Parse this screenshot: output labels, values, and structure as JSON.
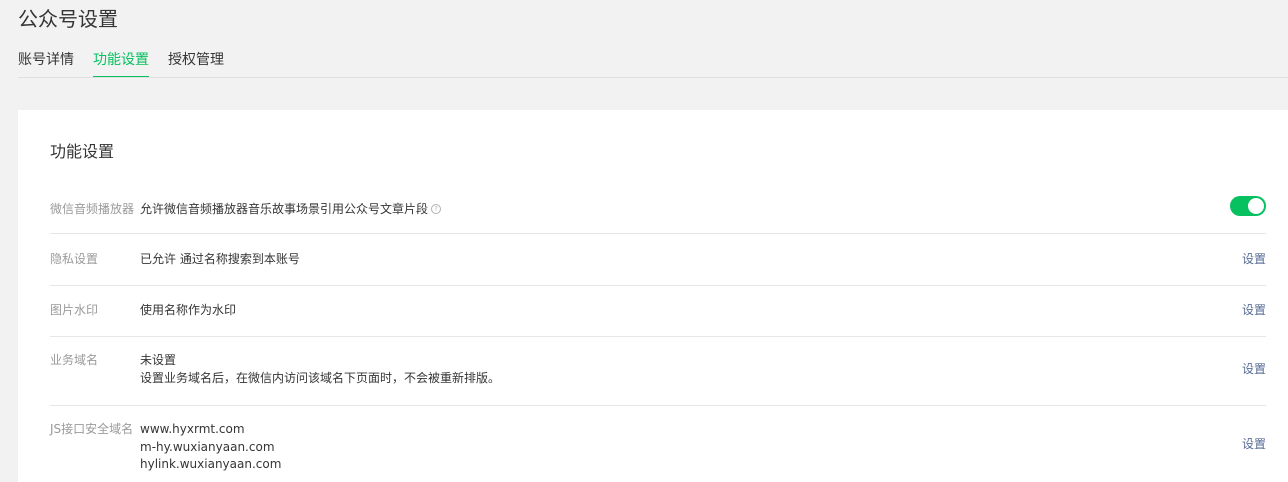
{
  "page": {
    "title": "公众号设置"
  },
  "tabs": [
    {
      "label": "账号详情",
      "active": false
    },
    {
      "label": "功能设置",
      "active": true
    },
    {
      "label": "授权管理",
      "active": false
    }
  ],
  "section": {
    "title": "功能设置"
  },
  "rows": {
    "player": {
      "label": "微信音频播放器",
      "content": "允许微信音频播放器音乐故事场景引用公众号文章片段",
      "help_icon": "?",
      "toggle_on": true
    },
    "privacy": {
      "label": "隐私设置",
      "content": "已允许 通过名称搜索到本账号",
      "action": "设置"
    },
    "watermark": {
      "label": "图片水印",
      "content": "使用名称作为水印",
      "action": "设置"
    },
    "business_domain": {
      "label": "业务域名",
      "line1": "未设置",
      "line2": "设置业务域名后，在微信内访问该域名下页面时，不会被重新排版。",
      "action": "设置"
    },
    "js_domain": {
      "label": "JS接口安全域名",
      "domains": [
        "www.hyxrmt.com",
        "m-hy.wuxianyaan.com",
        "hylink.wuxianyaan.com"
      ],
      "action": "设置"
    }
  },
  "colors": {
    "accent": "#07c160",
    "link": "#576b95",
    "label": "#9a9a9a"
  }
}
